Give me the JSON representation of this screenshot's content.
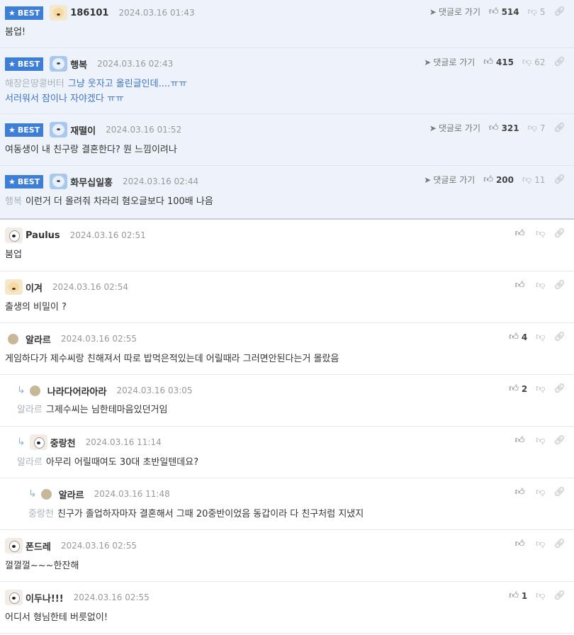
{
  "best_badge": "BEST",
  "goto_label": "댓글로 가기",
  "best_comments": [
    {
      "nick": "186101",
      "date": "2024.03.16 01:43",
      "up": "514",
      "down": "5",
      "lines": [
        "붐업!"
      ],
      "target": ""
    },
    {
      "nick": "행복",
      "date": "2024.03.16 02:43",
      "up": "415",
      "down": "62",
      "lines": [
        "그냥 웃자고 올린글인데....ㅠㅠ",
        "서러워서 잠이나 자야겠다 ㅠㅠ"
      ],
      "target": "해장은땅콩버터"
    },
    {
      "nick": "재떨이",
      "date": "2024.03.16 01:52",
      "up": "321",
      "down": "7",
      "lines": [
        "여동생이 내 친구랑 결혼한다? 뭔 느낌이려나"
      ],
      "target": ""
    },
    {
      "nick": "화무십일홍",
      "date": "2024.03.16 02:44",
      "up": "200",
      "down": "11",
      "lines": [
        "이런거 더 올려줘 차라리 혐오글보다 100배 나음"
      ],
      "target": "행복"
    }
  ],
  "comments": [
    {
      "nick": "Paulus",
      "date": "2024.03.16 02:51",
      "up": "",
      "target": "",
      "text": "붐업"
    },
    {
      "nick": "이겨",
      "date": "2024.03.16 02:54",
      "up": "",
      "target": "",
      "text": "출생의 비밀이 ?"
    },
    {
      "nick": "알라르",
      "date": "2024.03.16 02:55",
      "up": "4",
      "target": "",
      "text": "게임하다가 제수씨랑 친해져서 따로 밥먹은적있는데 어릴때라 그러면안된다는거 몰랐음"
    },
    {
      "nick": "나라다어라아라",
      "date": "2024.03.16 03:05",
      "up": "2",
      "target": "알라르",
      "text": "그제수씨는 님한테마음있던거임"
    },
    {
      "nick": "중랑천",
      "date": "2024.03.16 11:14",
      "up": "",
      "target": "알라르",
      "text": "아무리 어릴때여도 30대 초반일텐데요?"
    },
    {
      "nick": "알라르",
      "date": "2024.03.16 11:48",
      "up": "",
      "target": "중랑천",
      "text": "친구가 졸업하자마자 결혼해서 그때 20중반이었음 동갑이라 다 친구처럼 지냈지"
    },
    {
      "nick": "폰드레",
      "date": "2024.03.16 02:55",
      "up": "",
      "target": "",
      "text": "껄껄껄~~~한잔해"
    },
    {
      "nick": "이두나!!!",
      "date": "2024.03.16 02:55",
      "up": "1",
      "target": "",
      "text": "어디서 형님한테 버릇없이!"
    }
  ]
}
